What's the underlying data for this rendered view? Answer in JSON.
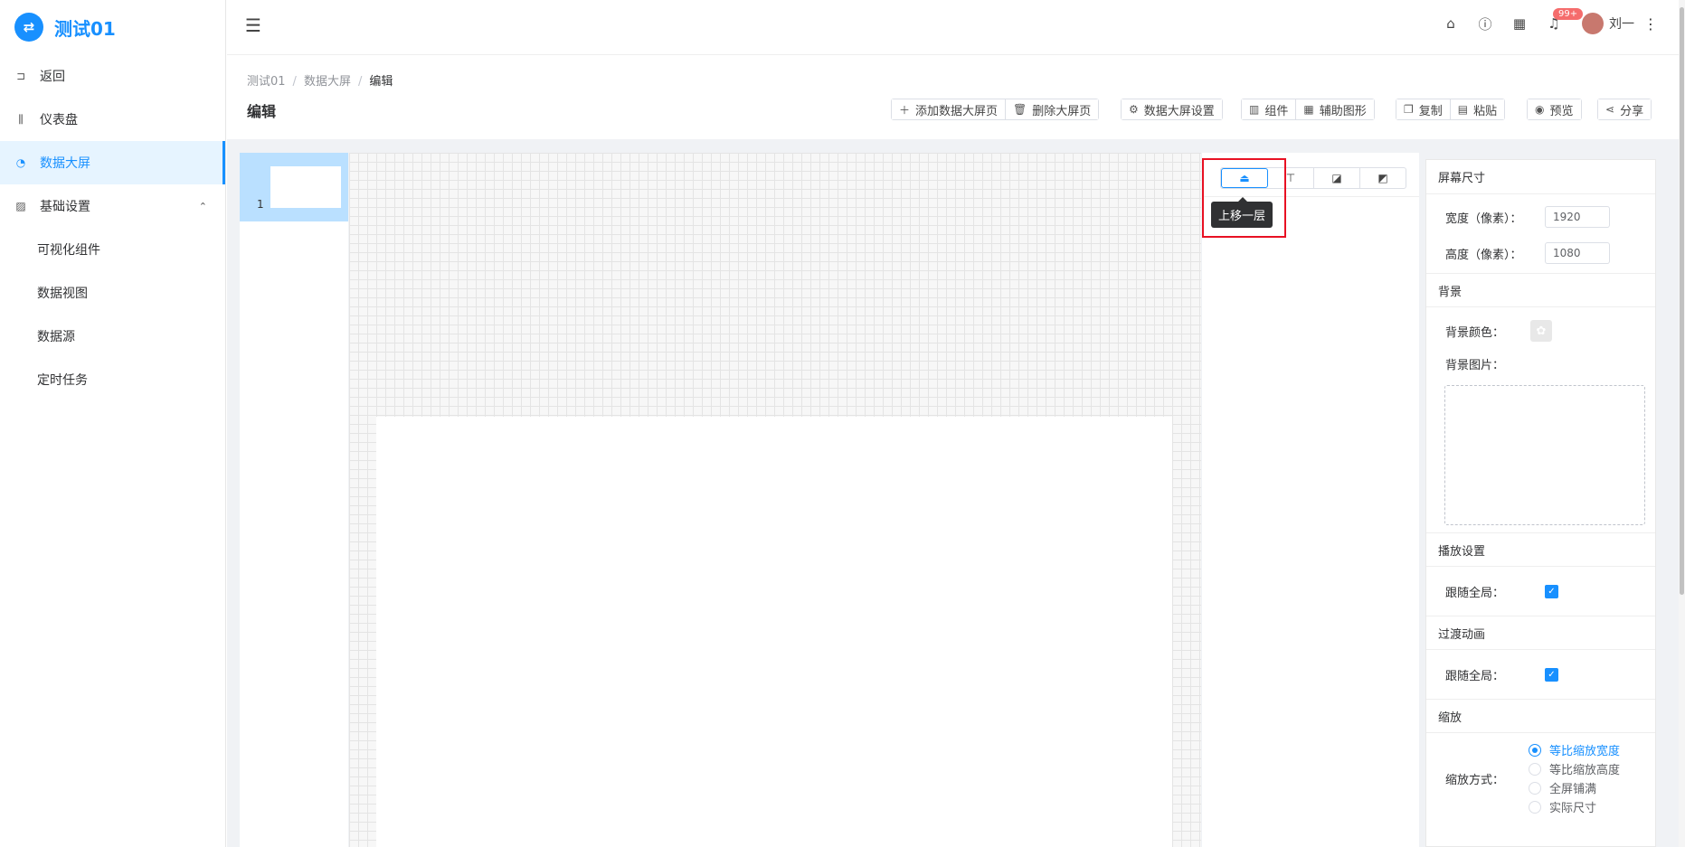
{
  "app": {
    "logo_glyph": "⇄",
    "title": "测试01",
    "brand_color": "#1890ff"
  },
  "sidebar": {
    "items": [
      {
        "label": "返回"
      },
      {
        "label": "仪表盘"
      },
      {
        "label": "数据大屏"
      },
      {
        "label": "基础设置"
      }
    ],
    "sub_items": [
      {
        "label": "可视化组件"
      },
      {
        "label": "数据视图"
      },
      {
        "label": "数据源"
      },
      {
        "label": "定时任务"
      }
    ]
  },
  "topbar": {
    "notification_badge": "99+",
    "username": "刘一"
  },
  "breadcrumb": {
    "items": [
      "测试01",
      "数据大屏",
      "编辑"
    ],
    "separator": "/"
  },
  "page": {
    "title": "编辑"
  },
  "toolbar": {
    "add_page": "添加数据大屏页",
    "delete_page": "删除大屏页",
    "settings": "数据大屏设置",
    "components": "组件",
    "aux_shapes": "辅助图形",
    "copy": "复制",
    "paste": "粘贴",
    "preview": "预览",
    "share": "分享"
  },
  "thumbs": [
    {
      "number": "1"
    }
  ],
  "layer": {
    "tooltip": "上移一层"
  },
  "props": {
    "screen_size": {
      "title": "屏幕尺寸",
      "width_label": "宽度（像素）：",
      "width_value": "1920",
      "height_label": "高度（像素）：",
      "height_value": "1080"
    },
    "background": {
      "title": "背景",
      "color_label": "背景颜色：",
      "image_label": "背景图片："
    },
    "playback": {
      "title": "播放设置",
      "follow_label": "跟随全局：",
      "follow_checked": true
    },
    "transition": {
      "title": "过渡动画",
      "follow_label": "跟随全局：",
      "follow_checked": true
    },
    "scale": {
      "title": "缩放",
      "mode_label": "缩放方式：",
      "options": [
        "等比缩放宽度",
        "等比缩放高度",
        "全屏铺满",
        "实际尺寸"
      ],
      "selected": "等比缩放宽度"
    }
  }
}
